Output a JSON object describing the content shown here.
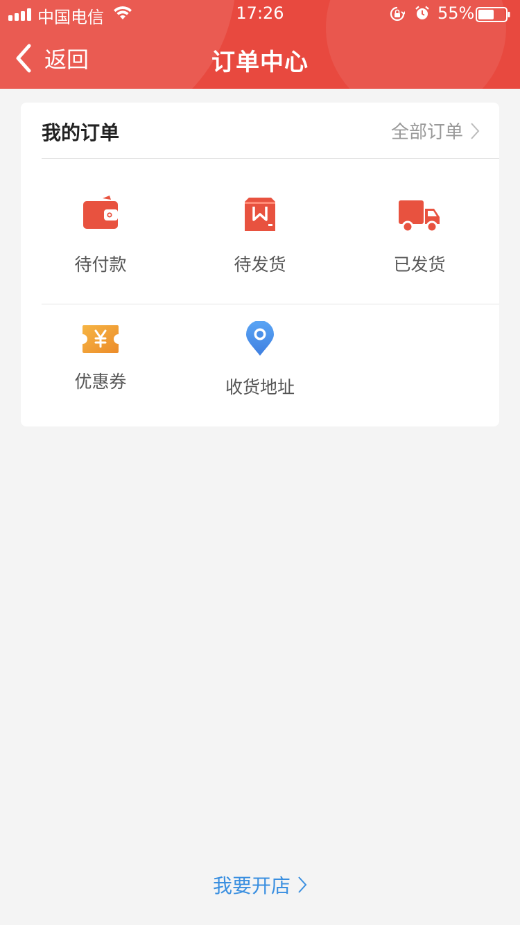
{
  "status_bar": {
    "carrier": "中国电信",
    "time": "17:26",
    "battery": "55%"
  },
  "nav": {
    "back_label": "返回",
    "title": "订单中心"
  },
  "orders": {
    "title": "我的订单",
    "all_link": "全部订单",
    "items": [
      {
        "label": "待付款",
        "icon": "wallet-icon"
      },
      {
        "label": "待发货",
        "icon": "package-icon"
      },
      {
        "label": "已发货",
        "icon": "truck-icon"
      },
      {
        "label": "优惠券",
        "icon": "coupon-icon"
      },
      {
        "label": "收货地址",
        "icon": "location-pin-icon"
      }
    ]
  },
  "footer": {
    "open_shop": "我要开店"
  },
  "colors": {
    "header": "#e8493f",
    "icon_red": "#e8523f",
    "coupon": "#f0a030",
    "pin": "#4a8fe8",
    "link_blue": "#3a8fe0"
  }
}
